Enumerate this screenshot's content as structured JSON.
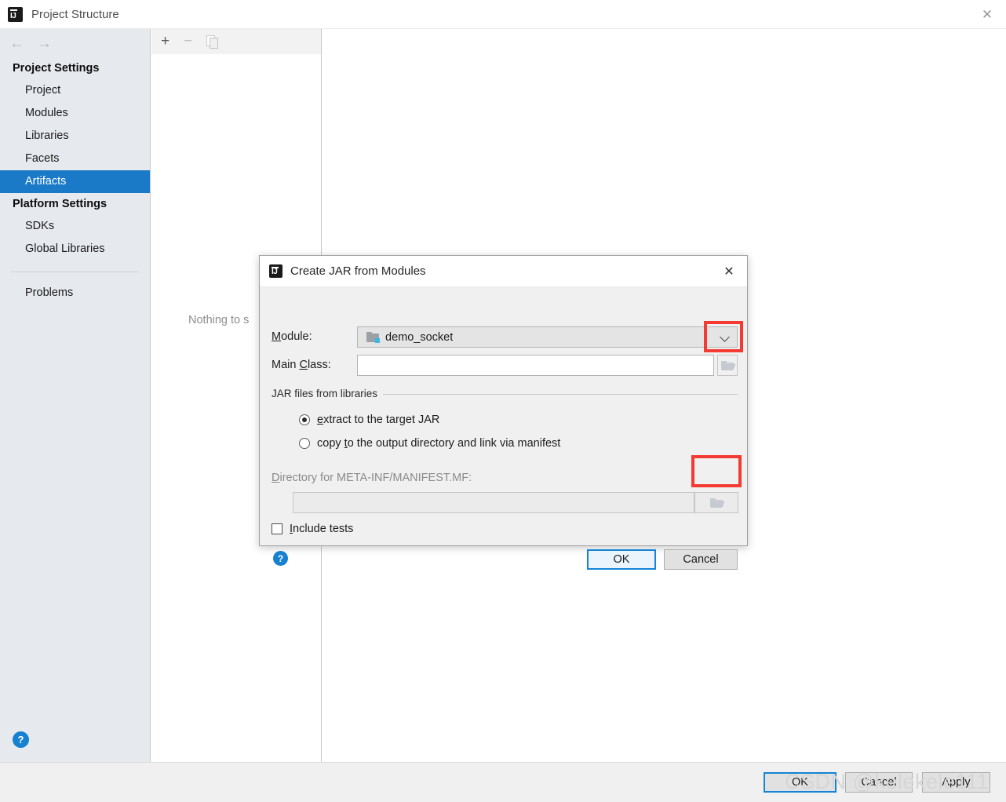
{
  "window": {
    "title": "Project Structure",
    "close_icon": "close-icon",
    "app_icon": "intellij-idea-icon",
    "app_icon_text": "IJ"
  },
  "nav": {
    "back_icon": "←",
    "forward_icon": "→",
    "groups": [
      {
        "title": "Project Settings",
        "items": [
          {
            "label": "Project",
            "selected": false
          },
          {
            "label": "Modules",
            "selected": false
          },
          {
            "label": "Libraries",
            "selected": false
          },
          {
            "label": "Facets",
            "selected": false
          },
          {
            "label": "Artifacts",
            "selected": true
          }
        ]
      },
      {
        "title": "Platform Settings",
        "items": [
          {
            "label": "SDKs",
            "selected": false
          },
          {
            "label": "Global Libraries",
            "selected": false
          }
        ]
      }
    ],
    "problems_label": "Problems",
    "help_label": "?"
  },
  "mid_panel": {
    "toolbar": {
      "add_label": "+",
      "remove_label": "−",
      "copy_icon": "copy-icon"
    },
    "empty_text": "Nothing to s"
  },
  "footer": {
    "ok_label": "OK",
    "cancel_label": "Cancel",
    "apply_label": "Apply"
  },
  "watermark": {
    "text": "CSDN @kelekele111"
  },
  "dialog": {
    "title": "Create JAR from Modules",
    "close_icon": "close-icon",
    "module": {
      "label": "M",
      "label_underlined": "o",
      "label_rest": "dule:",
      "value": "demo_socket",
      "icon": "module-folder-icon",
      "caret_icon": "chevron-down-icon"
    },
    "main_class": {
      "label_a": "Main ",
      "label_underlined": "C",
      "label_rest": "lass:",
      "value": "",
      "placeholder": "",
      "browse_icon": "folder-open-icon"
    },
    "jar_group": {
      "legend": "JAR files from libraries",
      "options": [
        {
          "prefix": "",
          "underlined": "e",
          "rest": "xtract to the target JAR",
          "checked": true
        },
        {
          "prefix": "copy ",
          "underlined": "t",
          "rest": "o the output directory and link via manifest",
          "checked": false
        }
      ]
    },
    "directory": {
      "label_underlined": "D",
      "label_rest": "irectory for META-INF/MANIFEST.MF:",
      "value": "",
      "placeholder": "",
      "browse_icon": "folder-open-icon"
    },
    "include_tests": {
      "underlined": "I",
      "rest": "nclude tests",
      "checked": false
    },
    "help_label": "?",
    "ok_label": "OK",
    "cancel_label": "Cancel"
  },
  "colors": {
    "selection_blue": "#1a7ac7",
    "annotation_red": "#f43a32",
    "help_blue": "#1681d0",
    "sidebar_bg": "#e6eaee"
  }
}
